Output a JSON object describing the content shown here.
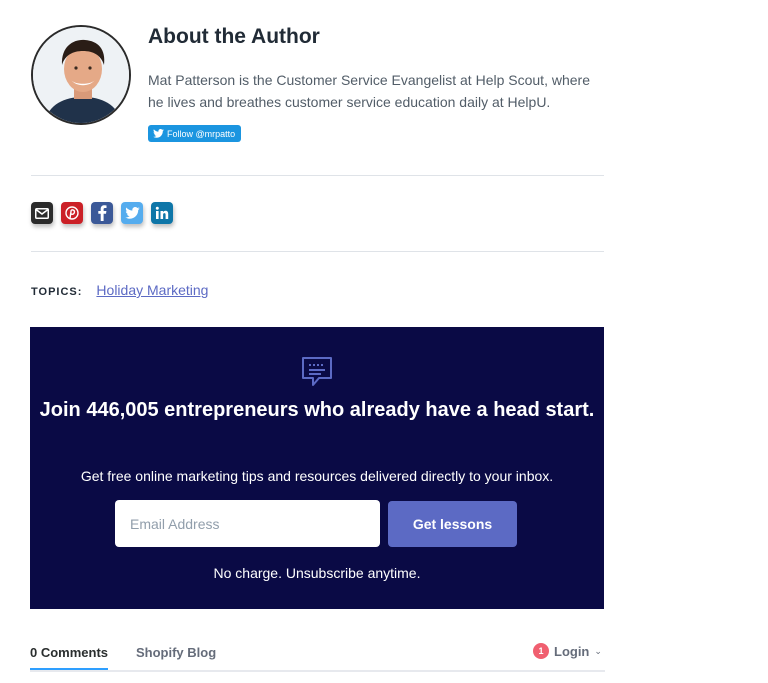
{
  "author": {
    "title": "About the Author",
    "bio": "Mat Patterson is the Customer Service Evangelist at Help Scout, where he lives and breathes customer service education daily at HelpU.",
    "follow_label": "Follow @mrpatto",
    "avatar_icon": "author-photo"
  },
  "share": {
    "icons": [
      "email-icon",
      "pinterest-icon",
      "facebook-icon",
      "twitter-icon",
      "linkedin-icon"
    ],
    "colors": {
      "email": "#2b2b2b",
      "pinterest": "#cb2027",
      "facebook": "#3b5998",
      "twitter": "#55acee",
      "linkedin": "#0e76a8"
    }
  },
  "topics": {
    "label": "TOPICS:",
    "link": "Holiday Marketing"
  },
  "newsletter": {
    "heading": "Join 446,005 entrepreneurs who already have a head start.",
    "subtitle": "Get free online marketing tips and resources delivered directly to your inbox.",
    "email_placeholder": "Email Address",
    "button_label": "Get lessons",
    "note": "No charge. Unsubscribe anytime.",
    "colors": {
      "background": "#0a0a45",
      "button": "#5c6ac4",
      "icon": "#5c6ac4"
    }
  },
  "comments": {
    "tab_active": "0 Comments",
    "tab_blog": "Shopify Blog",
    "login_badge": "1",
    "login_label": "Login",
    "login_caret": "⌄"
  }
}
